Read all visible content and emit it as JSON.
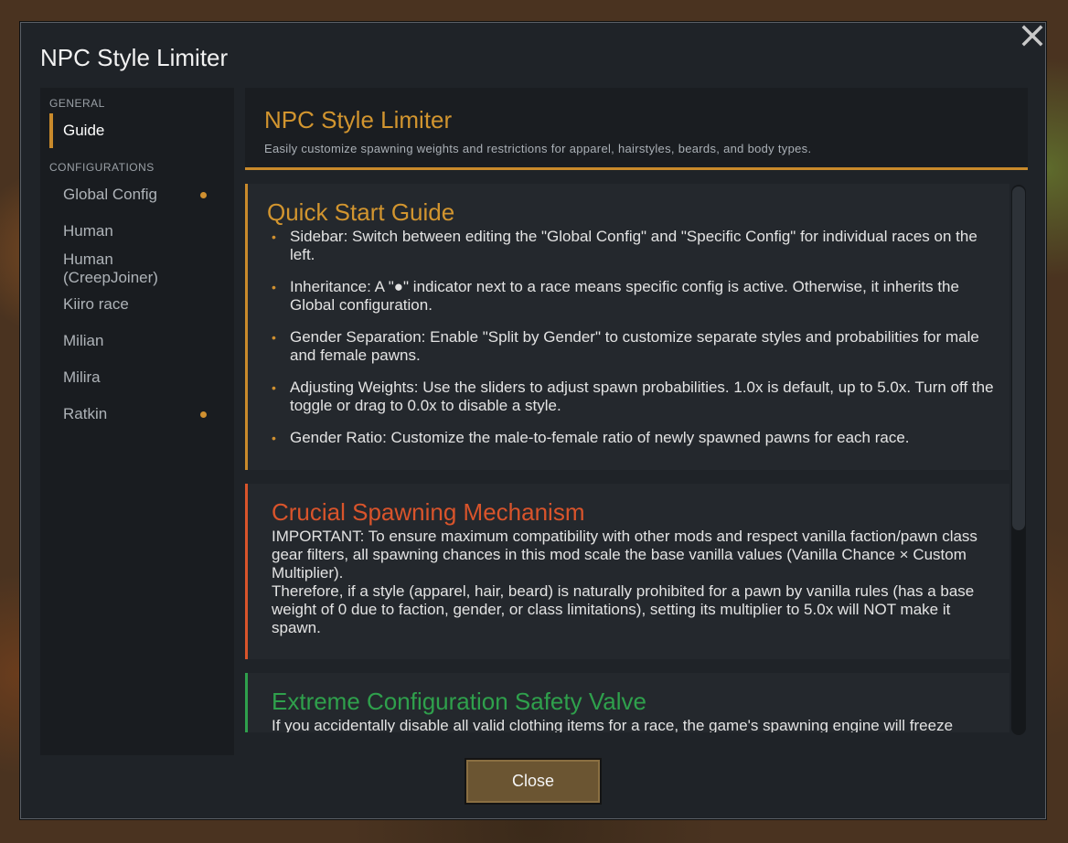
{
  "window": {
    "title": "NPC Style Limiter"
  },
  "sidebar": {
    "sections": [
      {
        "label": "GENERAL"
      },
      {
        "label": "CONFIGURATIONS"
      }
    ],
    "items": [
      {
        "label": "Guide",
        "active": true,
        "has_specific_config": false
      },
      {
        "label": "Global Config",
        "has_specific_config": true
      },
      {
        "label": "Human",
        "has_specific_config": false
      },
      {
        "label": "Human (CreepJoiner)",
        "has_specific_config": false
      },
      {
        "label": "Kiiro race",
        "has_specific_config": false
      },
      {
        "label": "Milian",
        "has_specific_config": false
      },
      {
        "label": "Milira",
        "has_specific_config": false
      },
      {
        "label": "Ratkin",
        "has_specific_config": true
      }
    ]
  },
  "header": {
    "title": "NPC Style Limiter",
    "subtitle": "Easily customize spawning weights and restrictions for apparel, hairstyles, beards, and body types."
  },
  "quick_start": {
    "title": "Quick Start Guide",
    "bullets": [
      "Sidebar: Switch between editing the \"Global Config\" and \"Specific Config\" for individual races on the left.",
      "Inheritance: A \"●\" indicator next to a race means specific config is active. Otherwise, it inherits the Global configuration.",
      "Gender Separation: Enable \"Split by Gender\" to customize separate styles and probabilities for male and female pawns.",
      "Adjusting Weights: Use the sliders to adjust spawn probabilities. 1.0x is default, up to 5.0x. Turn off the toggle or drag to 0.0x to disable a style.",
      "Gender Ratio: Customize the male-to-female ratio of newly spawned pawns for each race."
    ]
  },
  "crucial": {
    "title": "Crucial Spawning Mechanism",
    "para1": "IMPORTANT: To ensure maximum compatibility with other mods and respect vanilla faction/pawn class gear filters, all spawning chances in this mod scale the base vanilla values (Vanilla Chance × Custom Multiplier).",
    "para2": "Therefore, if a style (apparel, hair, beard) is naturally prohibited for a pawn by vanilla rules (has a base weight of 0 due to faction, gender, or class limitations), setting its multiplier to 5.0x will NOT make it spawn."
  },
  "safety": {
    "title": "Extreme Configuration Safety Valve",
    "para1": "If you accidentally disable all valid clothing items for a race, the game's spawning engine will freeze"
  },
  "buttons": {
    "close": "Close"
  },
  "colors": {
    "accent": "#c98a2b",
    "crucial": "#d9542b",
    "safety": "#2fa04c",
    "bullet": "#d09030"
  },
  "icons": {
    "close": "close-icon",
    "bullet": "bullet-dot-icon",
    "indicator": "config-indicator-dot"
  }
}
